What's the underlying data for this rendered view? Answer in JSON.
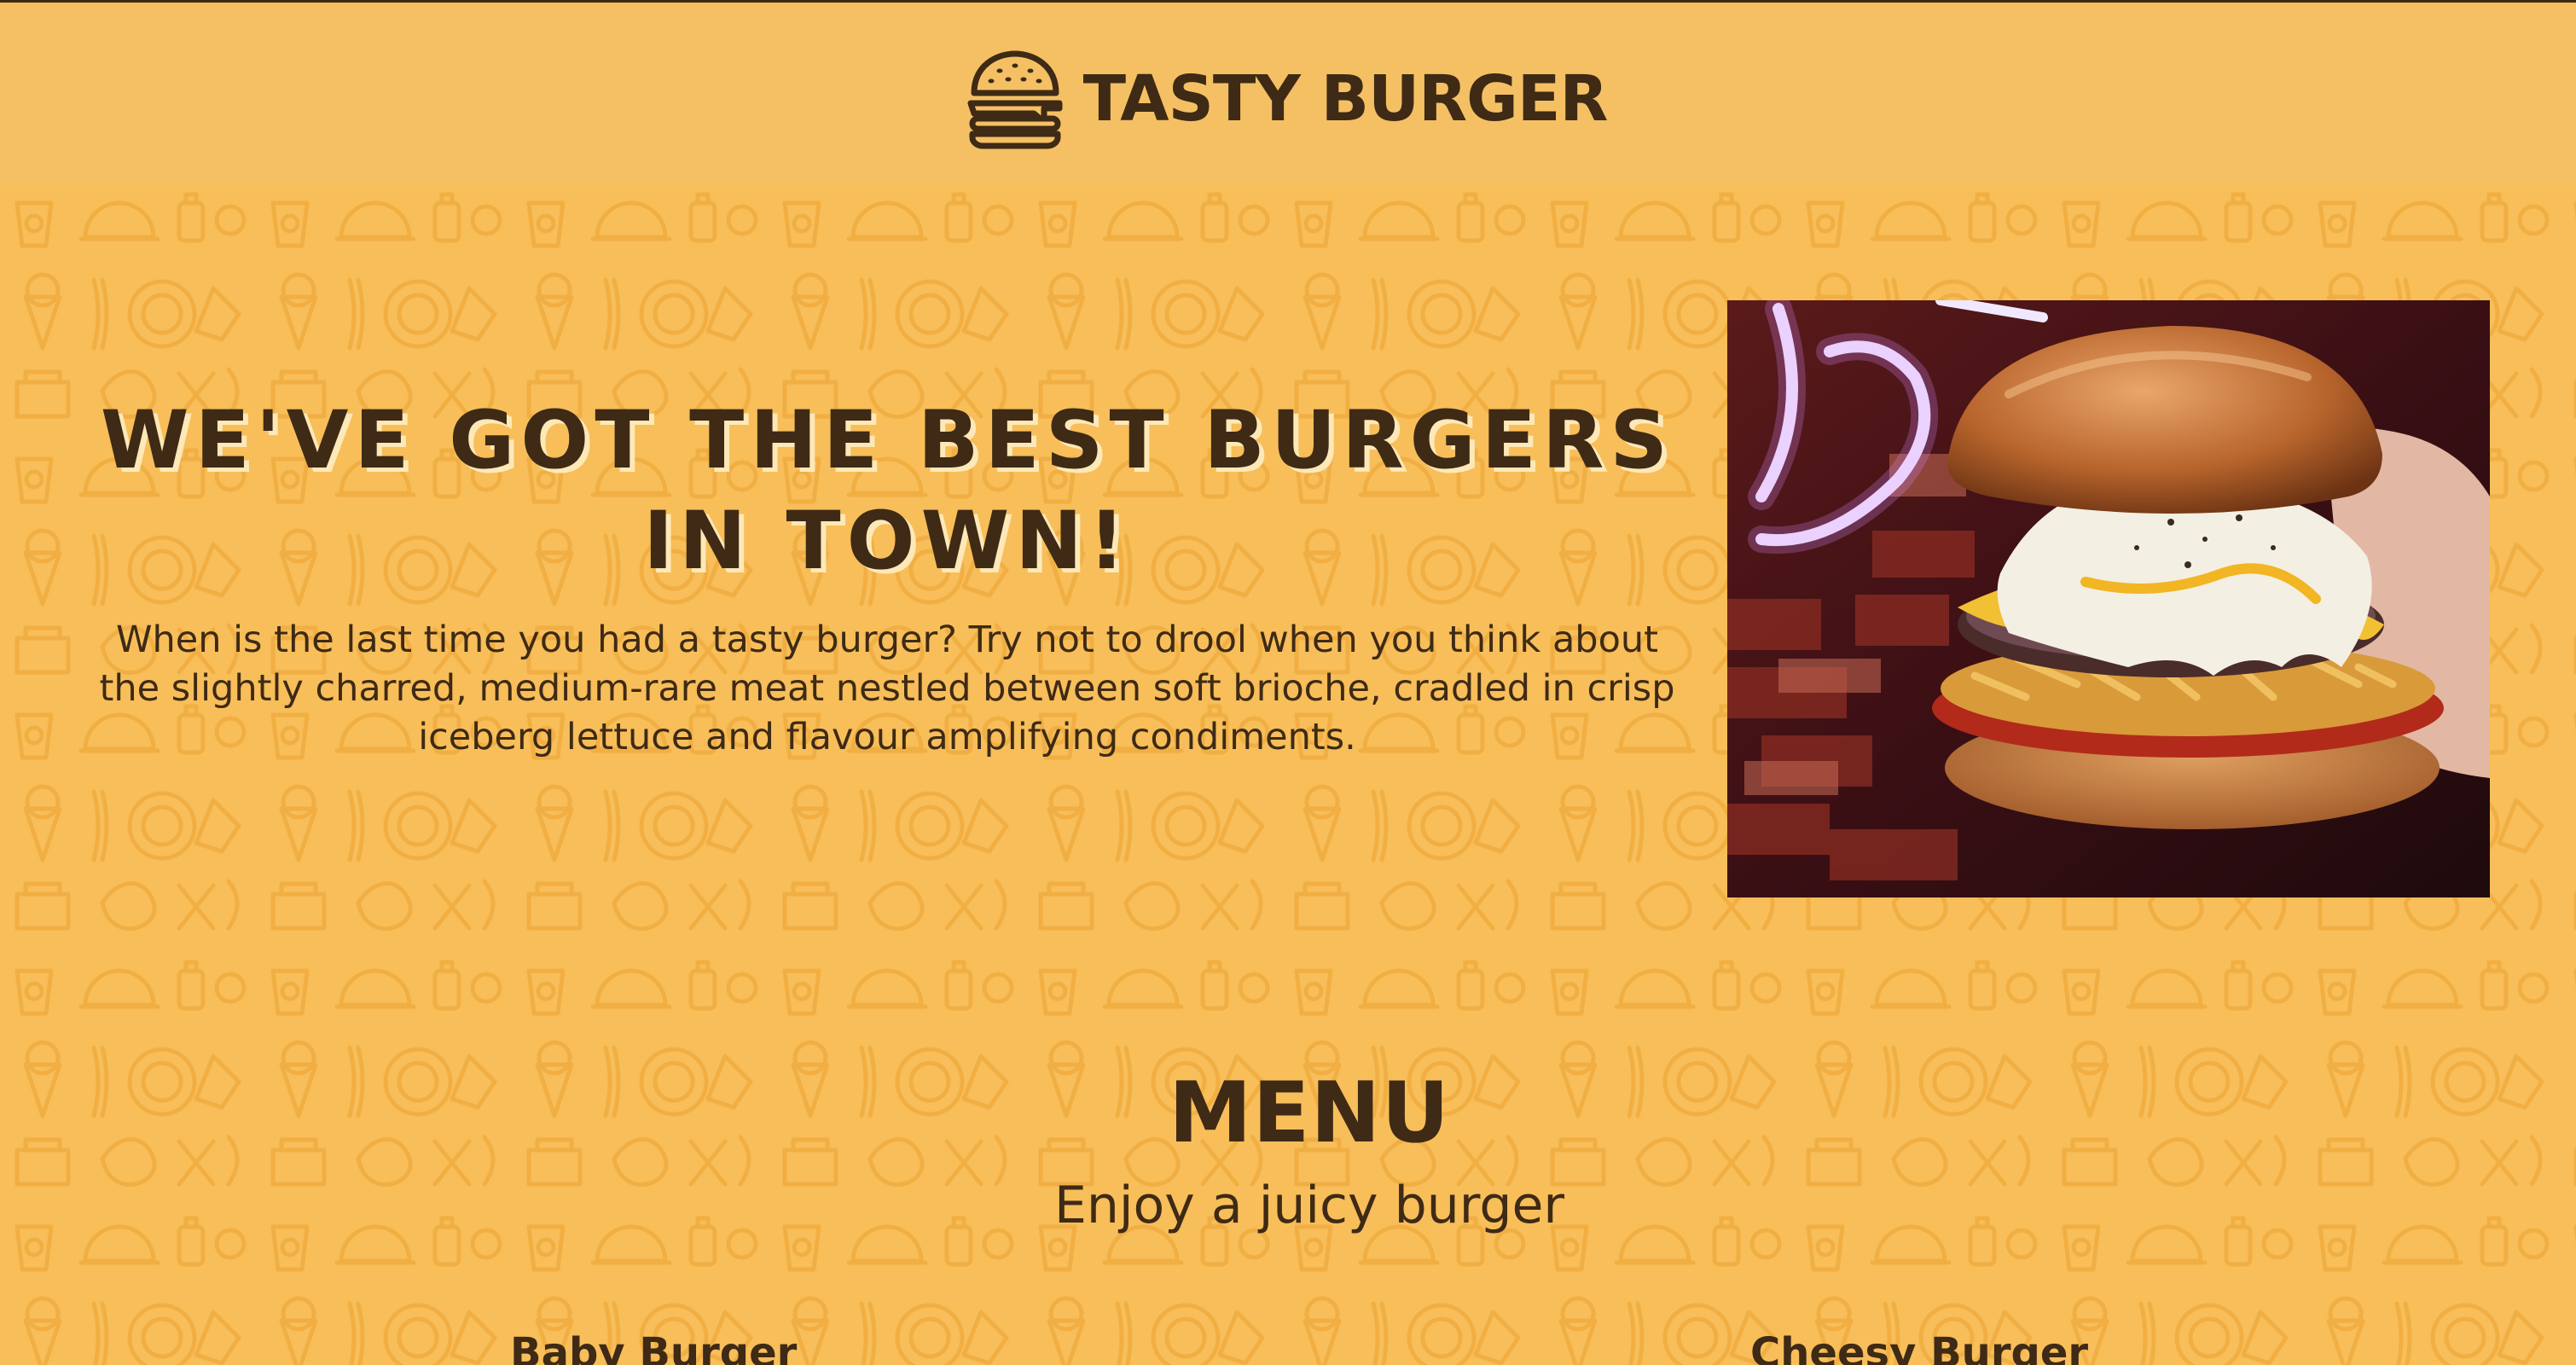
{
  "header": {
    "brand_name": "TASTY BURGER",
    "logo_icon": "burger-icon"
  },
  "hero": {
    "title": "We've got the best burgers in town!",
    "description": "When is the last time you had a tasty burger? Try not to drool when you think about the slightly charred, medium-rare meat nestled between soft brioche, cradled in crisp iceberg lettuce and flavour amplifying condiments.",
    "image_subject": "burger-photo"
  },
  "menu": {
    "heading": "MENU",
    "subtitle": "Enjoy a juicy burger",
    "items": [
      {
        "name": "Baby Burger"
      },
      {
        "name": "Cheesy Burger"
      }
    ]
  },
  "colors": {
    "background": "#f7be5a",
    "header_background": "#f5c063",
    "text": "#3e2a15",
    "text_shadow": "#fde8b8"
  }
}
